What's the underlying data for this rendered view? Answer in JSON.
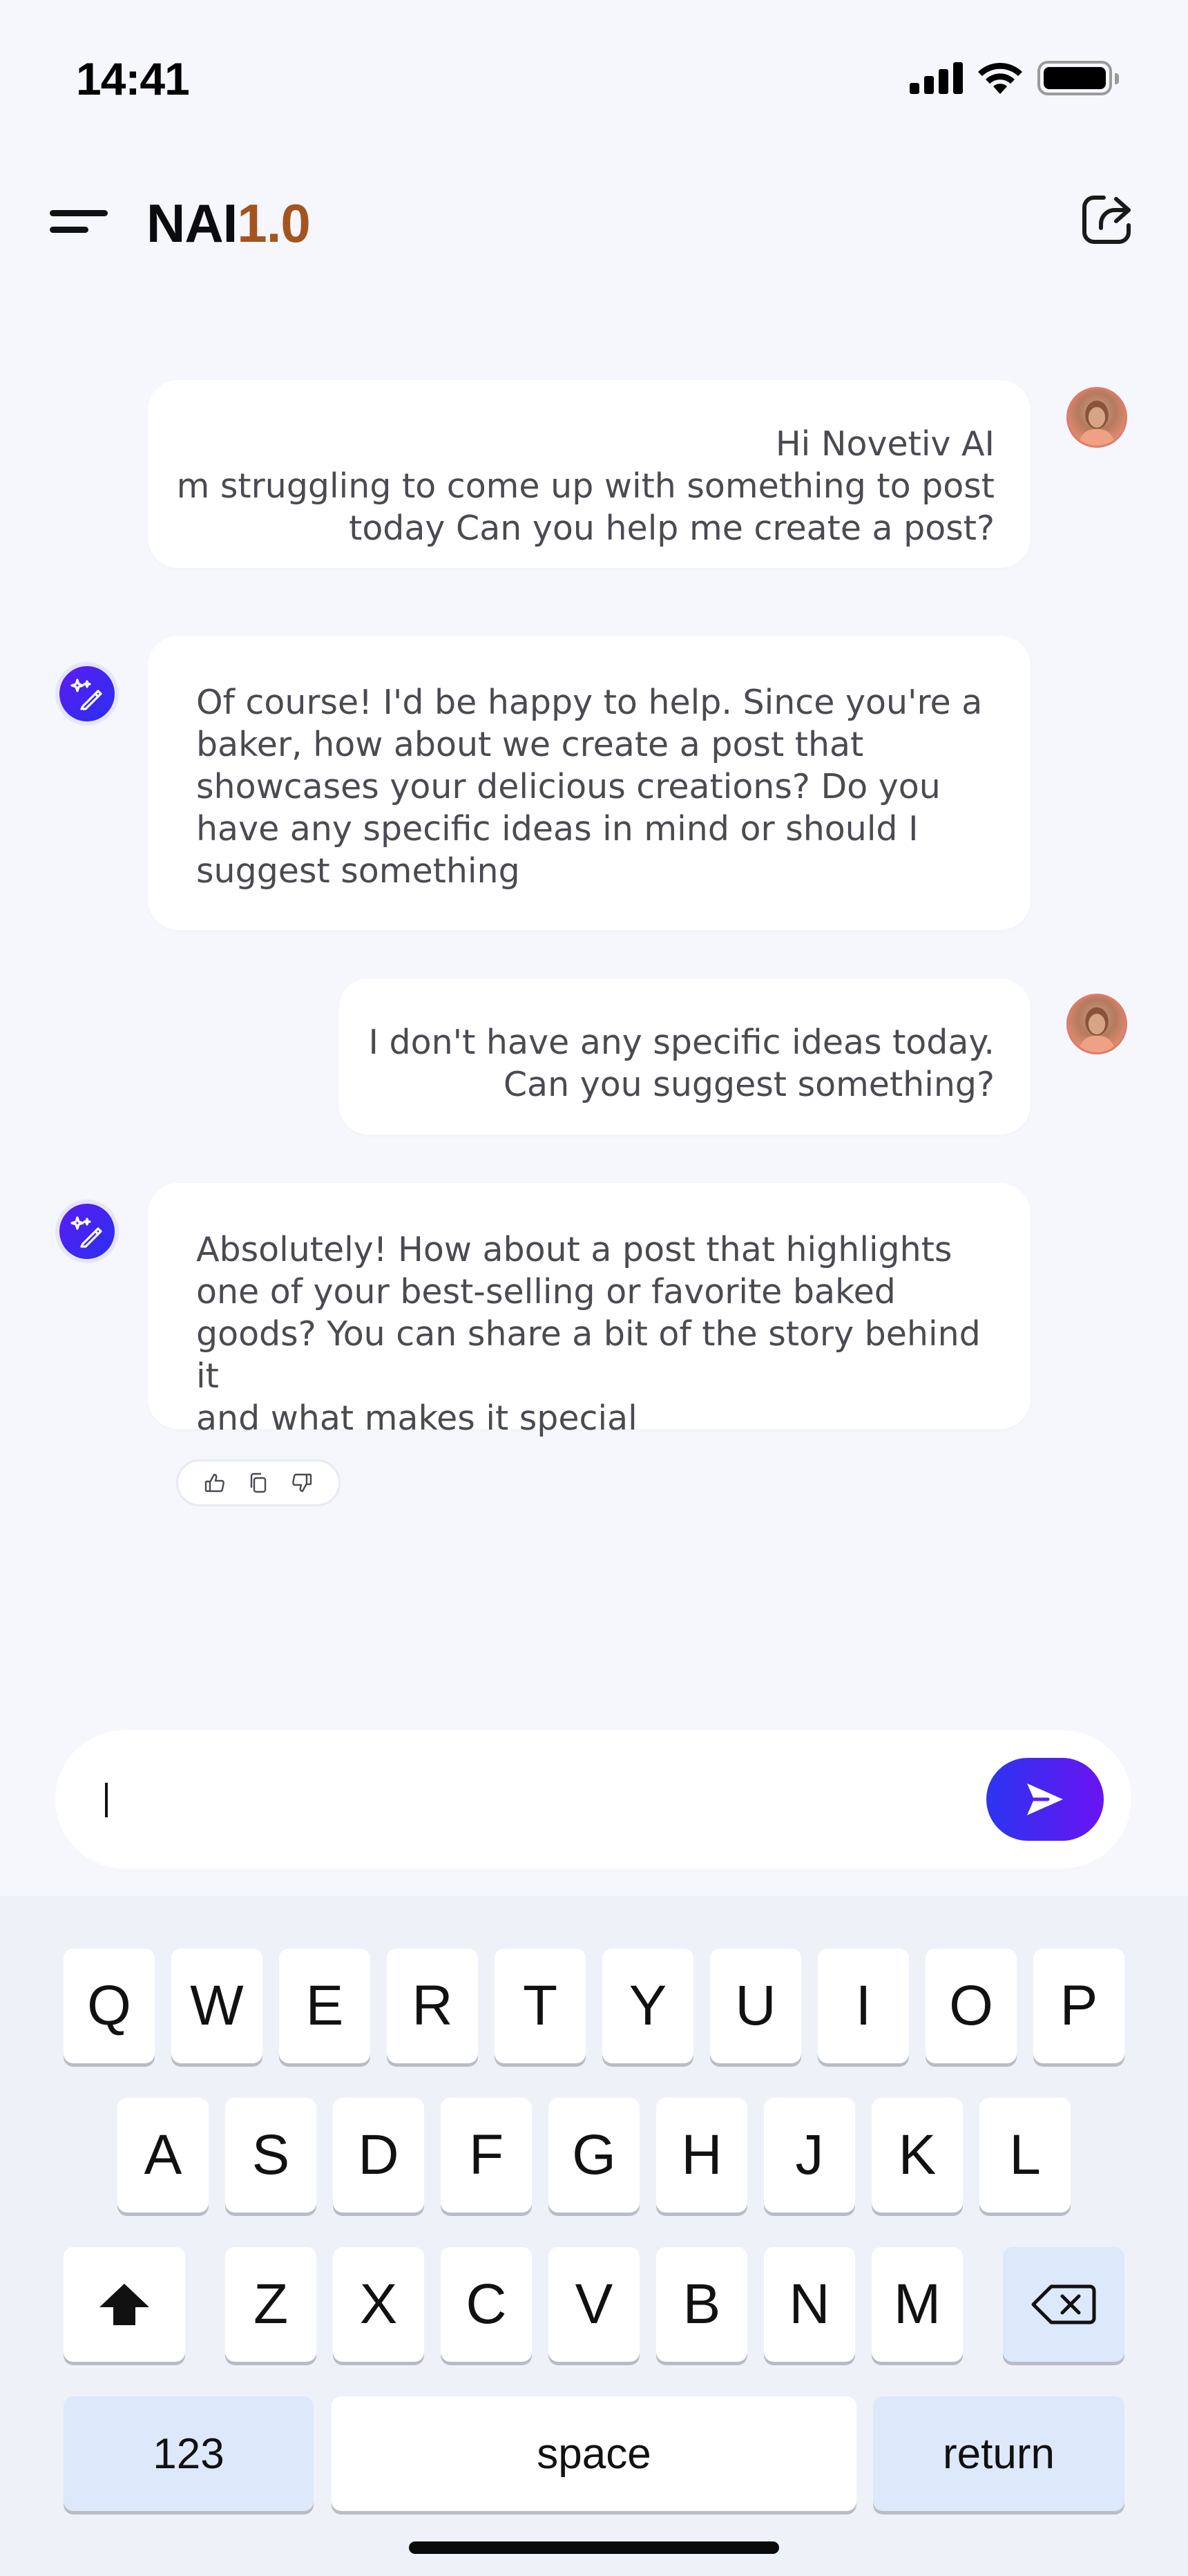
{
  "status_bar": {
    "time": "14:41",
    "icons": [
      "cellular-signal-icon",
      "wifi-icon",
      "battery-icon"
    ]
  },
  "header": {
    "brand_name": "NAI",
    "brand_version": "1.0",
    "menu_icon": "hamburger-menu-icon",
    "share_icon": "share-icon"
  },
  "colors": {
    "brand_accent": "#a4541f",
    "send_gradient_start": "#2b35f2",
    "send_gradient_end": "#6a14f2",
    "background": "#f5f7fd",
    "keyboard_special": "#dde8fb"
  },
  "messages": [
    {
      "sender": "user",
      "text": "Hi Novetiv AI \nm struggling to come up with something to post\ntoday  Can you help me create a post?"
    },
    {
      "sender": "ai",
      "text": "Of course! I'd be happy to help. Since you're a\nbaker, how about we create a post that\nshowcases your delicious creations? Do you\nhave any specific ideas in mind or should I\nsuggest something"
    },
    {
      "sender": "user",
      "text": "I don't have any specific ideas today.\nCan you suggest something?"
    },
    {
      "sender": "ai",
      "text": "Absolutely! How about a post that highlights\none of your best-selling or favorite baked\ngoods? You can share a bit of the story behind it\nand what makes it special"
    }
  ],
  "feedback_actions": [
    "thumbs-up-icon",
    "copy-icon",
    "thumbs-down-icon"
  ],
  "composer": {
    "value": "",
    "send_icon": "send-icon"
  },
  "keyboard": {
    "row1": [
      "Q",
      "W",
      "E",
      "R",
      "T",
      "Y",
      "U",
      "I",
      "O",
      "P"
    ],
    "row2": [
      "A",
      "S",
      "D",
      "F",
      "G",
      "H",
      "J",
      "K",
      "L"
    ],
    "row3": [
      "Z",
      "X",
      "C",
      "V",
      "B",
      "N",
      "M"
    ],
    "shift_icon": "shift-icon",
    "delete_icon": "backspace-icon",
    "numbers_label": "123",
    "space_label": "space",
    "return_label": "return"
  }
}
